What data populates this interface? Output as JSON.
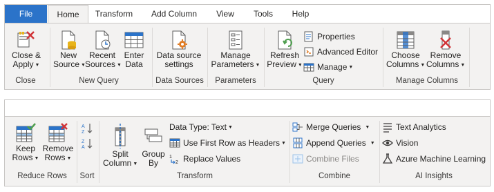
{
  "ribbon_top": {
    "tabs": [
      {
        "label": "File"
      },
      {
        "label": "Home"
      },
      {
        "label": "Transform"
      },
      {
        "label": "Add Column"
      },
      {
        "label": "View"
      },
      {
        "label": "Tools"
      },
      {
        "label": "Help"
      }
    ],
    "groups": {
      "close": {
        "label": "Close",
        "close_apply": {
          "line1": "Close &",
          "line2": "Apply"
        }
      },
      "new_query": {
        "label": "New Query",
        "new_source": {
          "line1": "New",
          "line2": "Source"
        },
        "recent_sources": {
          "line1": "Recent",
          "line2": "Sources"
        },
        "enter_data": {
          "line1": "Enter",
          "line2": "Data"
        }
      },
      "data_sources": {
        "label": "Data Sources",
        "settings": {
          "line1": "Data source",
          "line2": "settings"
        }
      },
      "parameters": {
        "label": "Parameters",
        "manage": {
          "line1": "Manage",
          "line2": "Parameters"
        }
      },
      "query": {
        "label": "Query",
        "refresh": {
          "line1": "Refresh",
          "line2": "Preview"
        },
        "properties": "Properties",
        "advanced_editor": "Advanced Editor",
        "manage": "Manage"
      },
      "manage_columns": {
        "label": "Manage Columns",
        "choose": {
          "line1": "Choose",
          "line2": "Columns"
        },
        "remove": {
          "line1": "Remove",
          "line2": "Columns"
        }
      }
    }
  },
  "ribbon_bottom": {
    "groups": {
      "reduce_rows": {
        "label": "Reduce Rows",
        "keep": {
          "line1": "Keep",
          "line2": "Rows"
        },
        "remove": {
          "line1": "Remove",
          "line2": "Rows"
        }
      },
      "sort": {
        "label": "Sort"
      },
      "transform": {
        "label": "Transform",
        "split": {
          "line1": "Split",
          "line2": "Column"
        },
        "group": {
          "line1": "Group",
          "line2": "By"
        },
        "data_type": "Data Type: Text",
        "first_row": "Use First Row as Headers",
        "replace": "Replace Values"
      },
      "combine": {
        "label": "Combine",
        "merge": "Merge Queries",
        "append": "Append Queries",
        "combine_files": "Combine Files"
      },
      "ai_insights": {
        "label": "AI Insights",
        "text_analytics": "Text Analytics",
        "vision": "Vision",
        "azure_ml": "Azure Machine Learning"
      }
    }
  },
  "colors": {
    "file_tab": "#2b73c9",
    "ribbon_bg": "#f3f2f1",
    "accent_orange": "#e07b23",
    "accent_red": "#d13438",
    "accent_green": "#4f9e4f",
    "icon_blue": "#2b73c9"
  }
}
